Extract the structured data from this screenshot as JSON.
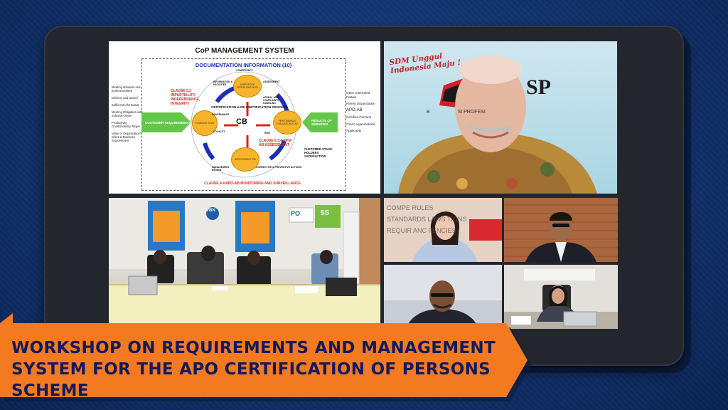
{
  "slide": {
    "title": "CoP MANAGEMENT SYSTEM",
    "doc_info": "DOCUMENTATION INFORMATION (10)",
    "left_list": [
      "Meeting standard and professionalism",
      "Delivery and Speed",
      "Sufficient Information",
      "Meeting Obligation with Scheme Owner",
      "Productivity Goals/Industry Target",
      "Value to Organization/ Client & Business Improvement"
    ],
    "right_list": [
      "Other Interested Parties",
      "Parent Organization",
      "APO-AB",
      "Certified Persons",
      "Client organizations",
      "Applicants"
    ],
    "customer_requirements": "CUSTOMER REQUIREMENTS",
    "results_of_services": "RESULTS OF SERVICES",
    "customer_satisfaction": "CUSTOMER STAKE-HOLDERS SATISFACTION",
    "clause_52": "CLAUSE 5.2 IMPARTIALITY, INDEPENDENCE, INTEGRITY",
    "clause_634": "CLAUSE 6.3.4 APO-AB ASSESSMENT",
    "clause_44": "CLAUSE 4.4 APO-AB MONITORING AND SURVEILLANCE",
    "process": "CERTIFICATION & RE-CERTIFICATION PROCESS",
    "cb": "CB",
    "orbs": [
      "SUPPORTIVE OPERATIONS RCCB",
      "PLANNING HOUS",
      "PERFORMANCE EVALUATION RCAB",
      "IMPROVEMENT SOI"
    ],
    "small_labels": [
      "COMPETENCY",
      "INFORMATION & FACILITIES",
      "ASSESSMENT",
      "APPEAL AND COMPLAINTS HANDLING",
      "GOVERNANCE",
      "LOCALITY",
      "MANAGEMENT REVIEW",
      "CORRECTIVE & PREVENTIVE ACTIONS",
      "RISK"
    ]
  },
  "speaker": {
    "slogan_line1": "SDM Unggul",
    "slogan_line2": "Indonesia Maju !",
    "logo_text": "SP",
    "logo_sub": "B                    SI PROFESI"
  },
  "room": {
    "logos": [
      "VBN",
      "PO",
      "5S"
    ]
  },
  "participants": {
    "p1_backdrop": "COMPE RULES STANDARDS LAWS TIONS REQUIR ANC FENCIES"
  },
  "banner": {
    "line1": "WORKSHOP ON REQUIREMENTS AND MANAGEMENT",
    "line2": "SYSTEM FOR THE APO CERTIFICATION OF PERSONS SCHEME"
  },
  "colors": {
    "background": "#133672",
    "banner": "#f47a21",
    "banner_text": "#111a5c",
    "tablet": "#23262d"
  }
}
